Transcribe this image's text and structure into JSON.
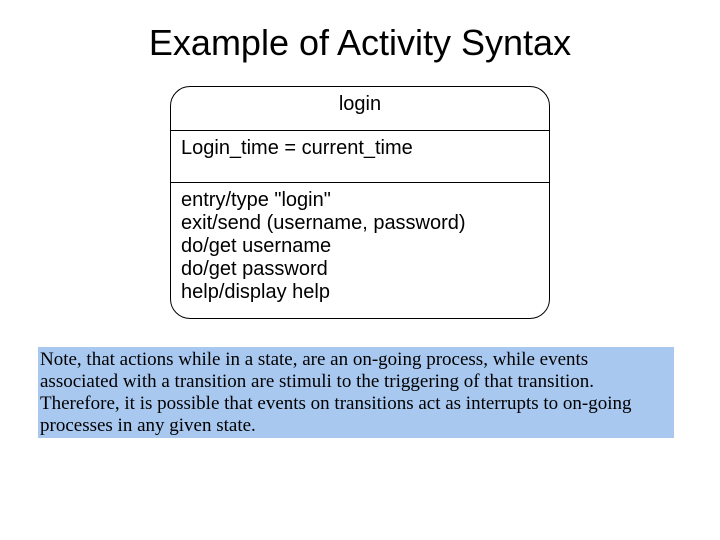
{
  "title": "Example of Activity Syntax",
  "state": {
    "name": "login",
    "internal": "Login_time = current_time",
    "actions": [
      "entry/type \"login\"",
      "exit/send (username, password)",
      "do/get username",
      "do/get password",
      "help/display help"
    ]
  },
  "note": "Note, that actions while in a state, are an on-going process, while events associated with a transition are stimuli to the triggering of that transition. Therefore, it is possible that events on transitions act as interrupts to on-going processes in any given state."
}
